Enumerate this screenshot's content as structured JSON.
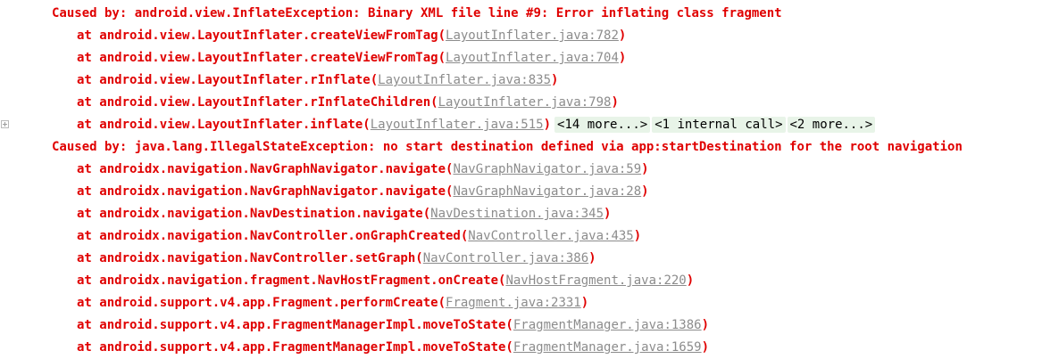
{
  "console": {
    "caused1": "Caused by: android.view.InflateException: Binary XML file line #9: Error inflating class fragment",
    "frames1": [
      {
        "at": "at android.view.LayoutInflater.createViewFromTag(",
        "src": "LayoutInflater.java:782",
        "end": ")"
      },
      {
        "at": "at android.view.LayoutInflater.createViewFromTag(",
        "src": "LayoutInflater.java:704",
        "end": ")"
      },
      {
        "at": "at android.view.LayoutInflater.rInflate(",
        "src": "LayoutInflater.java:835",
        "end": ")"
      },
      {
        "at": "at android.view.LayoutInflater.rInflateChildren(",
        "src": "LayoutInflater.java:798",
        "end": ")"
      },
      {
        "at": "at android.view.LayoutInflater.inflate(",
        "src": "LayoutInflater.java:515",
        "end": ")"
      }
    ],
    "folds": [
      "<14 more...>",
      "<1 internal call>",
      "<2 more...>"
    ],
    "caused2": "Caused by: java.lang.IllegalStateException: no start destination defined via app:startDestination for the root navigation",
    "frames2": [
      {
        "at": "at androidx.navigation.NavGraphNavigator.navigate(",
        "src": "NavGraphNavigator.java:59",
        "end": ")"
      },
      {
        "at": "at androidx.navigation.NavGraphNavigator.navigate(",
        "src": "NavGraphNavigator.java:28",
        "end": ")"
      },
      {
        "at": "at androidx.navigation.NavDestination.navigate(",
        "src": "NavDestination.java:345",
        "end": ")"
      },
      {
        "at": "at androidx.navigation.NavController.onGraphCreated(",
        "src": "NavController.java:435",
        "end": ")"
      },
      {
        "at": "at androidx.navigation.NavController.setGraph(",
        "src": "NavController.java:386",
        "end": ")"
      },
      {
        "at": "at androidx.navigation.fragment.NavHostFragment.onCreate(",
        "src": "NavHostFragment.java:220",
        "end": ")"
      },
      {
        "at": "at android.support.v4.app.Fragment.performCreate(",
        "src": "Fragment.java:2331",
        "end": ")"
      },
      {
        "at": "at android.support.v4.app.FragmentManagerImpl.moveToState(",
        "src": "FragmentManager.java:1386",
        "end": ")"
      },
      {
        "at": "at android.support.v4.app.FragmentManagerImpl.moveToState(",
        "src": "FragmentManager.java:1659",
        "end": ")"
      }
    ]
  },
  "colors": {
    "error_text": "#e00000",
    "source_link": "#8c8c8c",
    "fold_background": "#e8f4e8"
  },
  "icons": {
    "gutter": "expand-icon"
  }
}
